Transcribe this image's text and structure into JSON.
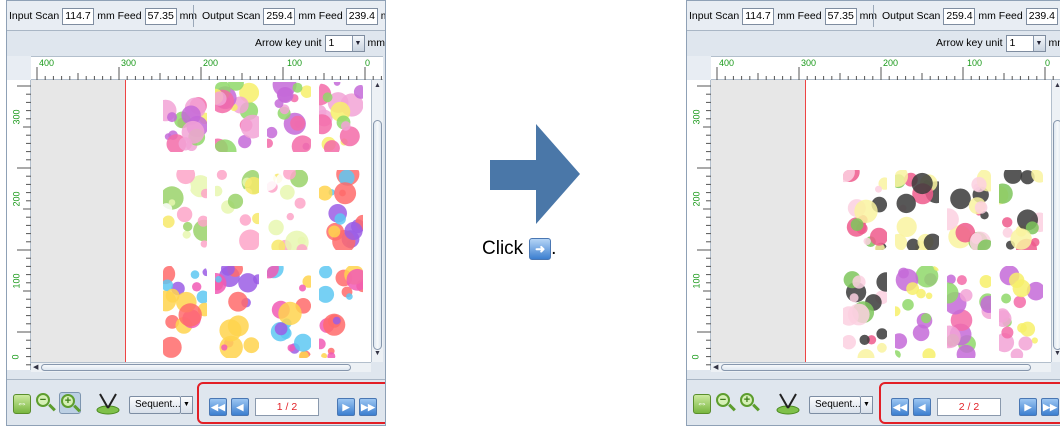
{
  "left_panel": {
    "input_scan_label": "Input Scan",
    "input_scan_value": "114.7",
    "input_mm1": "mm",
    "input_feed_label": "Feed",
    "input_feed_value": "57.35",
    "input_mm2": "mm",
    "output_scan_label": "Output Scan",
    "output_scan_value": "259.4",
    "output_mm1": "mm",
    "output_feed_label": "Feed",
    "output_feed_value": "239.4",
    "output_mm2": "mm",
    "arrow_key_label": "Arrow key unit",
    "arrow_key_value": "1",
    "arrow_key_unit": "mm",
    "ruler_h": [
      "400",
      "300",
      "200",
      "100",
      "0"
    ],
    "ruler_v": [
      "300",
      "200",
      "100",
      "0"
    ],
    "order_label": "Sequent...",
    "page_indicator": "1 / 2"
  },
  "right_panel": {
    "input_scan_label": "Input Scan",
    "input_scan_value": "114.7",
    "input_mm1": "mm",
    "input_feed_label": "Feed",
    "input_feed_value": "57.35",
    "input_mm2": "mm",
    "output_scan_label": "Output Scan",
    "output_scan_value": "259.4",
    "output_mm1": "mm",
    "output_feed_label": "Feed",
    "output_feed_value": "239.4",
    "output_mm2": "mm",
    "arrow_key_label": "Arrow key unit",
    "arrow_key_value": "1",
    "arrow_key_unit": "mm",
    "ruler_h": [
      "400",
      "300",
      "200",
      "100",
      "0"
    ],
    "ruler_v": [
      "300",
      "200",
      "100",
      "0"
    ],
    "order_label": "Sequent...",
    "page_indicator": "2 / 2"
  },
  "instruction": {
    "text": "Click",
    "period": "."
  },
  "colors": {
    "highlight_red": "#e21f26",
    "arrow_blue": "#4a77a8",
    "ruler_green": "#1a9a1a"
  },
  "icons": {
    "fit": "fit-page-icon",
    "zoom_out": "zoom-out-icon",
    "zoom_in": "zoom-in-icon",
    "pen": "cut-pen-icon",
    "first": "first-page-icon",
    "prev": "previous-page-icon",
    "next": "next-page-icon",
    "last": "last-page-icon"
  }
}
